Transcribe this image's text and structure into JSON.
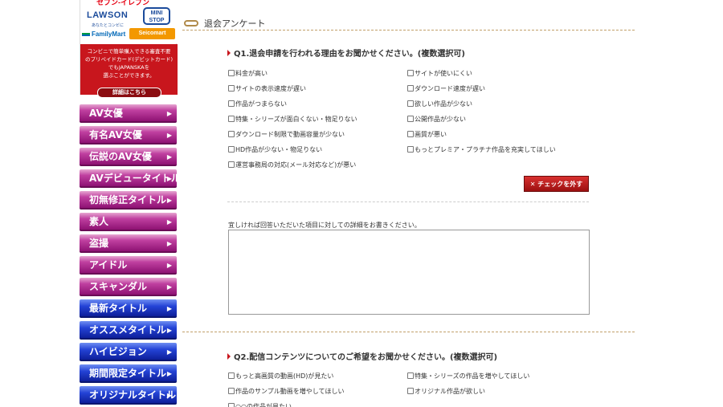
{
  "banner": {
    "seven_eleven": "セブン-イレブン",
    "lawson": "LAWSON",
    "lawson_sub": "あなたとコンビに",
    "ministop": "MINI STOP",
    "familymart": "FamilyMart",
    "seicomart": "Seicomart",
    "promo_line1": "コンビニで簡単購入できる審査不要",
    "promo_line2": "のプリペイドカード(デビットカード)",
    "promo_line3": "でもJAPANSKAを",
    "promo_line4": "選ぶことができます。",
    "detail_button": "詳細はこちら"
  },
  "nav": {
    "items": [
      {
        "label": "AV女優",
        "style": "pink"
      },
      {
        "label": "有名AV女優",
        "style": "pink"
      },
      {
        "label": "伝説のAV女優",
        "style": "pink"
      },
      {
        "label": "AVデビュータイトル",
        "style": "pink"
      },
      {
        "label": "初無修正タイトル",
        "style": "pink"
      },
      {
        "label": "素人",
        "style": "pink"
      },
      {
        "label": "盗撮",
        "style": "pink"
      },
      {
        "label": "アイドル",
        "style": "pink"
      },
      {
        "label": "スキャンダル",
        "style": "pink"
      },
      {
        "label": "最新タイトル",
        "style": "blue"
      },
      {
        "label": "オススメタイトル",
        "style": "blue"
      },
      {
        "label": "ハイビジョン",
        "style": "blue"
      },
      {
        "label": "期間限定タイトル",
        "style": "blue"
      },
      {
        "label": "オリジナルタイトル",
        "style": "blue"
      }
    ],
    "arrow": "▶"
  },
  "section": {
    "title": "退会アンケート"
  },
  "q1": {
    "title": "Q1.退会申請を行われる理由をお聞かせください。(複数選択可)",
    "options_left": [
      "料金が高い",
      "サイトの表示速度が遅い",
      "作品がつまらない",
      "特集・シリーズが面白くない・物足りない",
      "ダウンロード制限で動画容量が少ない",
      "HD作品が少ない・物足りない",
      "運営事務局の対応(メール対応など)が悪い"
    ],
    "options_right": [
      "サイトが使いにくい",
      "ダウンロード速度が遅い",
      "欲しい作品が少ない",
      "公開作品が少ない",
      "画質が悪い",
      "もっとプレミア・プラチナ作品を充実してほしい"
    ],
    "clear_button": "✕ チェックを外す",
    "detail_label": "宜しければ回答いただいた項目に対しての詳細をお書きください。",
    "detail_value": ""
  },
  "q2": {
    "title": "Q2.配信コンテンツについてのご希望をお聞かせください。(複数選択可)",
    "options_left": [
      "もっと高画質の動画(HD)が見たい",
      "作品のサンプル動画を増やしてほしい",
      "○○の作品が見たい"
    ],
    "options_right": [
      "特集・シリーズの作品を増やしてほしい",
      "オリジナル作品が欲しい"
    ]
  }
}
